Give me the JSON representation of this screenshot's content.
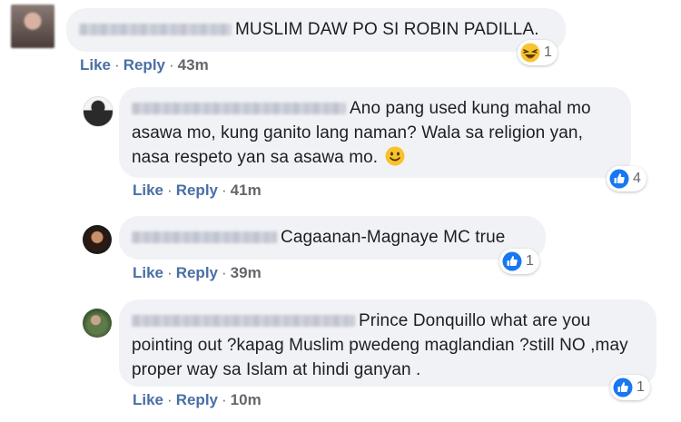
{
  "comments": [
    {
      "text": "MUSLIM DAW PO SI ROBIN PADILLA.",
      "like": "Like",
      "reply": "Reply",
      "time": "43m",
      "reaction": {
        "icon": "haha-icon",
        "count": "1"
      }
    },
    {
      "text": "Ano pang used kung mahal mo asawa mo, kung ganito lang naman? Wala sa religion yan, nasa respeto yan sa asawa mo.",
      "like": "Like",
      "reply": "Reply",
      "time": "41m",
      "reaction": {
        "icon": "like-icon",
        "count": "4"
      }
    },
    {
      "text": "Cagaanan-Magnaye MC true",
      "like": "Like",
      "reply": "Reply",
      "time": "39m",
      "reaction": {
        "icon": "like-icon",
        "count": "1"
      }
    },
    {
      "text": "Prince Donquillo what are you pointing out ?kapag Muslim pwedeng maglandian ?still NO ,may proper way sa Islam at hindi ganyan .",
      "like": "Like",
      "reply": "Reply",
      "time": "10m",
      "reaction": {
        "icon": "like-icon",
        "count": "1"
      }
    }
  ],
  "colors": {
    "bubble": "#f0f2f5",
    "link": "#4a6fa5",
    "like_blue": "#1877f2",
    "haha_yellow": "#f7c533"
  }
}
